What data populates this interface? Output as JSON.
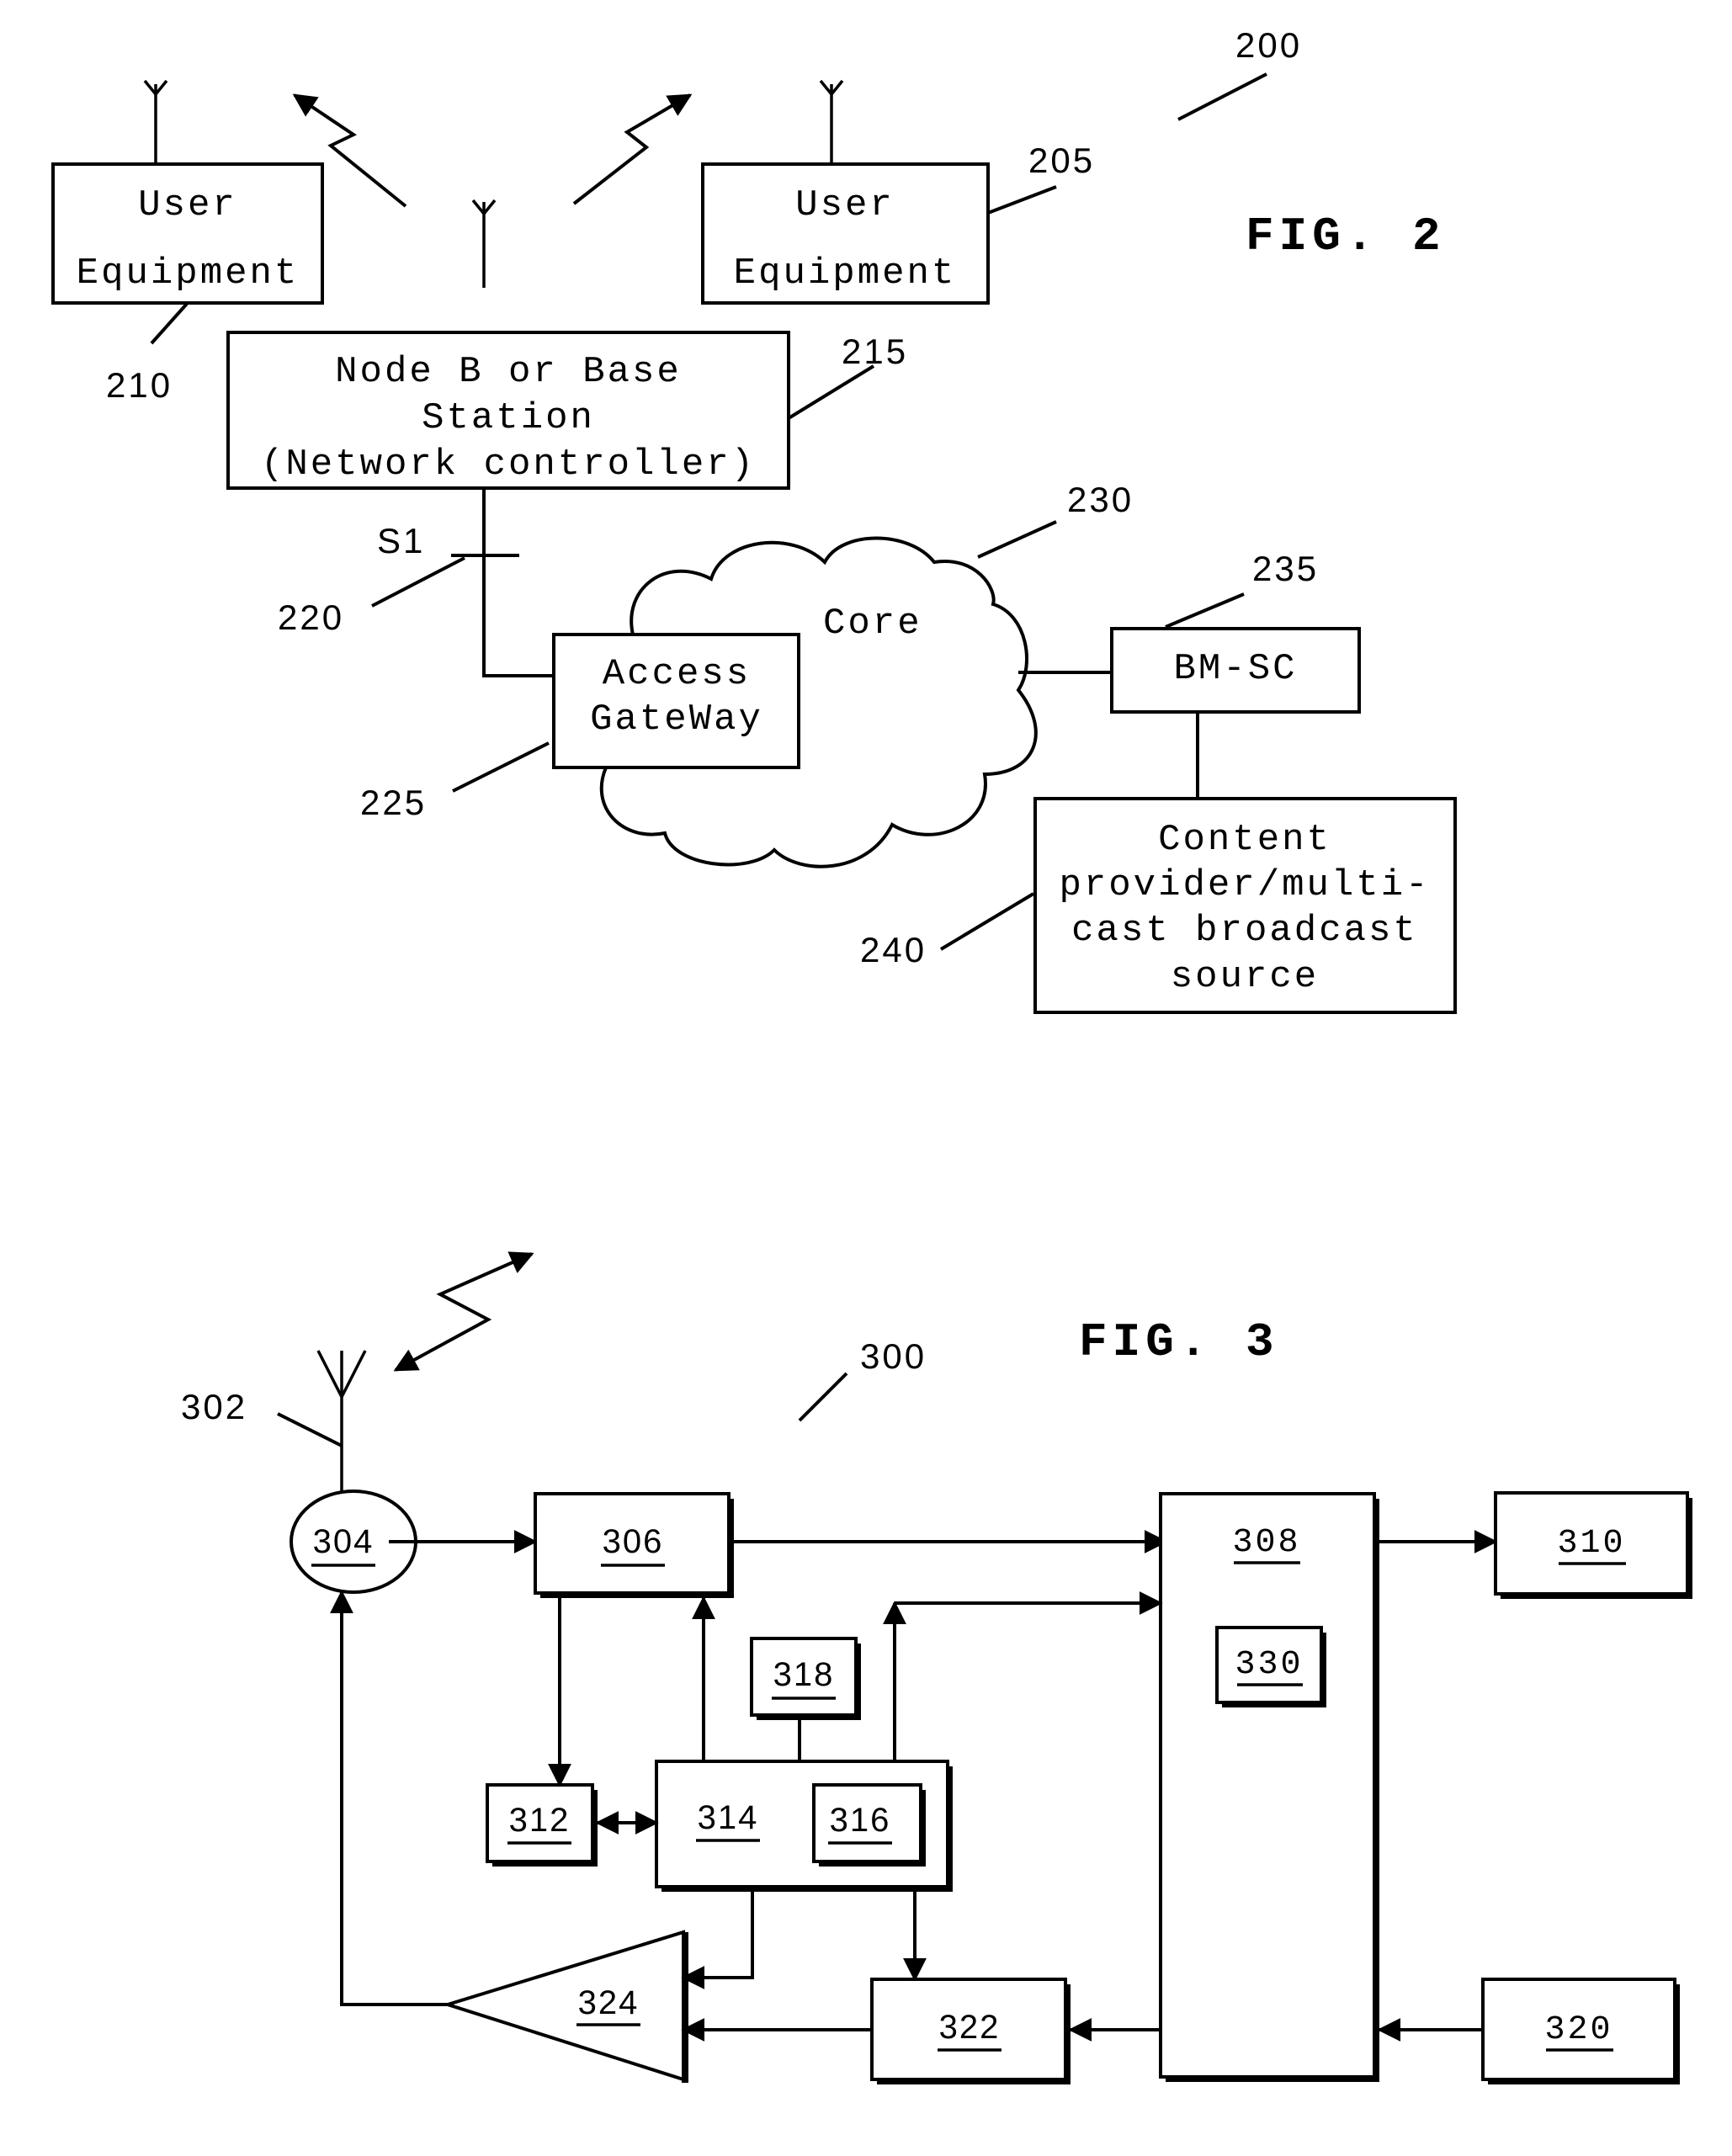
{
  "figure2": {
    "fig_label": "FIG. 2",
    "system_ref": "200",
    "ue_left": {
      "line1": "User",
      "line2": "Equipment",
      "ref": "210"
    },
    "ue_right": {
      "line1": "User",
      "line2": "Equipment",
      "ref": "205"
    },
    "node_b": {
      "line1": "Node B or Base",
      "line2": "Station",
      "line3": "(Network controller)",
      "ref": "215"
    },
    "interface": {
      "label": "S1",
      "ref": "220"
    },
    "access_gateway": {
      "line1": "Access",
      "line2": "GateWay",
      "ref": "225"
    },
    "core": {
      "label": "Core",
      "ref": "230"
    },
    "bmsc": {
      "label": "BM-SC",
      "ref": "235"
    },
    "content": {
      "line1": "Content",
      "line2": "provider/multi-",
      "line3": "cast broadcast",
      "line4": "source",
      "ref": "240"
    }
  },
  "figure3": {
    "fig_label": "FIG. 3",
    "system_ref": "300",
    "antenna_ref": "302",
    "blocks": {
      "b304": "304",
      "b306": "306",
      "b308": "308",
      "b310": "310",
      "b312": "312",
      "b314": "314",
      "b316": "316",
      "b318": "318",
      "b320": "320",
      "b322": "322",
      "b324": "324",
      "b330": "330"
    }
  }
}
